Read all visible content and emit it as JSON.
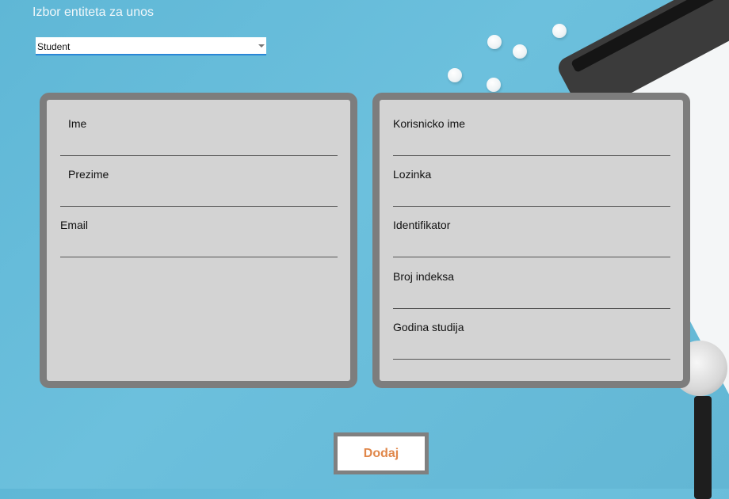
{
  "header": {
    "title": "Izbor entiteta za unos"
  },
  "entity_select": {
    "selected": "Student"
  },
  "left_panel": {
    "fields": [
      {
        "label": "Ime"
      },
      {
        "label": "Prezime"
      },
      {
        "label": "Email"
      }
    ]
  },
  "right_panel": {
    "fields": [
      {
        "label": "Korisnicko ime"
      },
      {
        "label": "Lozinka"
      },
      {
        "label": "Identifikator"
      },
      {
        "label": "Broj indeksa"
      },
      {
        "label": "Godina studija"
      }
    ]
  },
  "actions": {
    "submit_label": "Dodaj"
  },
  "colors": {
    "accent": "#2a86d6",
    "button_text": "#e0874a",
    "panel_border": "#7d7d7d",
    "panel_bg": "#d3d3d3"
  }
}
